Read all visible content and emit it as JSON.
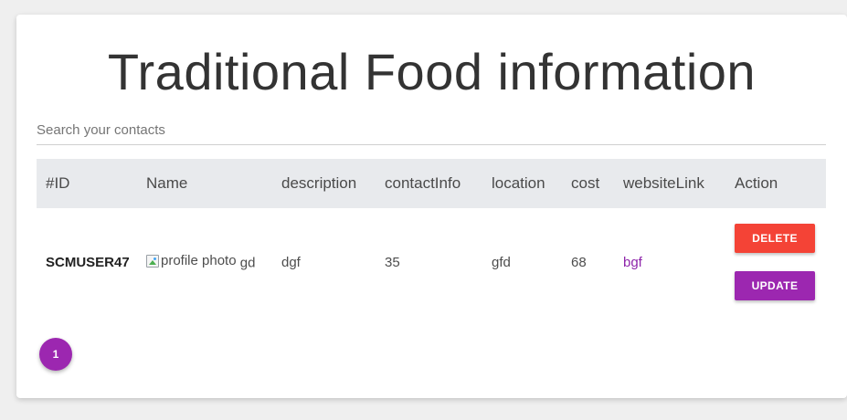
{
  "page": {
    "title": "Traditional Food information"
  },
  "search": {
    "placeholder": "Search your contacts",
    "value": ""
  },
  "table": {
    "headers": [
      "#ID",
      "Name",
      "description",
      "contactInfo",
      "location",
      "cost",
      "websiteLink",
      "Action"
    ],
    "rows": [
      {
        "id": "SCMUSER47",
        "image_alt": "profile photo",
        "name": "gd",
        "description": "dgf",
        "contactInfo": "35",
        "location": "gfd",
        "cost": "68",
        "websiteLink": "bgf",
        "delete_label": "DELETE",
        "update_label": "UPDATE"
      }
    ]
  },
  "pagination": {
    "current_page": "1"
  },
  "colors": {
    "delete": "#f44336",
    "update": "#9c27b0",
    "link": "#8e24aa",
    "header_bg": "#e8eaed"
  }
}
